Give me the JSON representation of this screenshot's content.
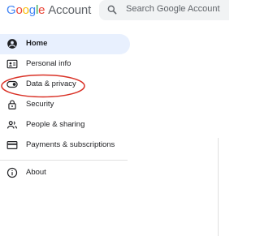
{
  "header": {
    "logo": {
      "letters": [
        "G",
        "o",
        "o",
        "g",
        "l",
        "e"
      ],
      "product": "Account"
    },
    "search": {
      "placeholder": "Search Google Account",
      "icon": "search-icon"
    }
  },
  "nav": {
    "items": [
      {
        "label": "Home",
        "icon": "account-circle-icon",
        "active": true
      },
      {
        "label": "Personal info",
        "icon": "id-card-icon"
      },
      {
        "label": "Data & privacy",
        "icon": "toggle-icon",
        "circled": true
      },
      {
        "label": "Security",
        "icon": "lock-icon"
      },
      {
        "label": "People & sharing",
        "icon": "people-icon"
      },
      {
        "label": "Payments & subscriptions",
        "icon": "credit-card-icon"
      },
      {
        "label": "About",
        "icon": "info-icon"
      }
    ]
  },
  "colors": {
    "active_bg": "#e8f0fe",
    "annotation": "#d93025"
  }
}
